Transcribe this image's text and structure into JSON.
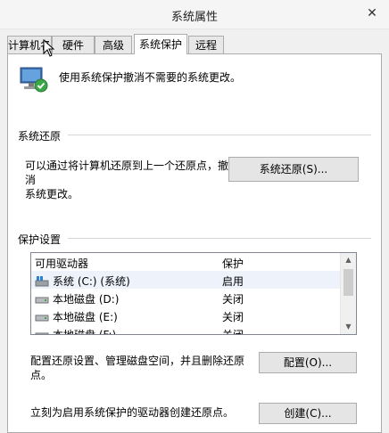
{
  "window": {
    "title": "系统属性",
    "close_glyph": "✕"
  },
  "tabs": [
    {
      "label": "计算机名"
    },
    {
      "label": "硬件"
    },
    {
      "label": "高级"
    },
    {
      "label": "系统保护",
      "active": true
    },
    {
      "label": "远程"
    }
  ],
  "intro": {
    "text": "使用系统保护撤消不需要的系统更改。",
    "icon": "system-protection-icon"
  },
  "restore": {
    "heading": "系统还原",
    "description_line1": "可以通过将计算机还原到上一个还原点，撤消",
    "description_line2": "系统更改。",
    "button_label": "系统还原(S)..."
  },
  "protection": {
    "heading": "保护设置",
    "columns": [
      "可用驱动器",
      "保护"
    ],
    "rows": [
      {
        "drive": "系统 (C:) (系统)",
        "status": "启用",
        "icon": "system-drive-icon"
      },
      {
        "drive": "本地磁盘 (D:)",
        "status": "关闭",
        "icon": "disk-drive-icon"
      },
      {
        "drive": "本地磁盘 (E:)",
        "status": "关闭",
        "icon": "disk-drive-icon"
      },
      {
        "drive": "本地磁盘 (F:)",
        "status": "关闭",
        "icon": "disk-drive-icon"
      }
    ]
  },
  "configure": {
    "description": "配置还原设置、管理磁盘空间，并且删除还原点。",
    "button_label": "配置(O)..."
  },
  "create": {
    "description": "立刻为启用系统保护的驱动器创建还原点。",
    "button_label": "创建(C)..."
  },
  "colors": {
    "panel_bg": "#ffffff",
    "chrome_bg": "#f0f0f0",
    "button_bg": "#e5e5e5",
    "border": "#acacac"
  }
}
